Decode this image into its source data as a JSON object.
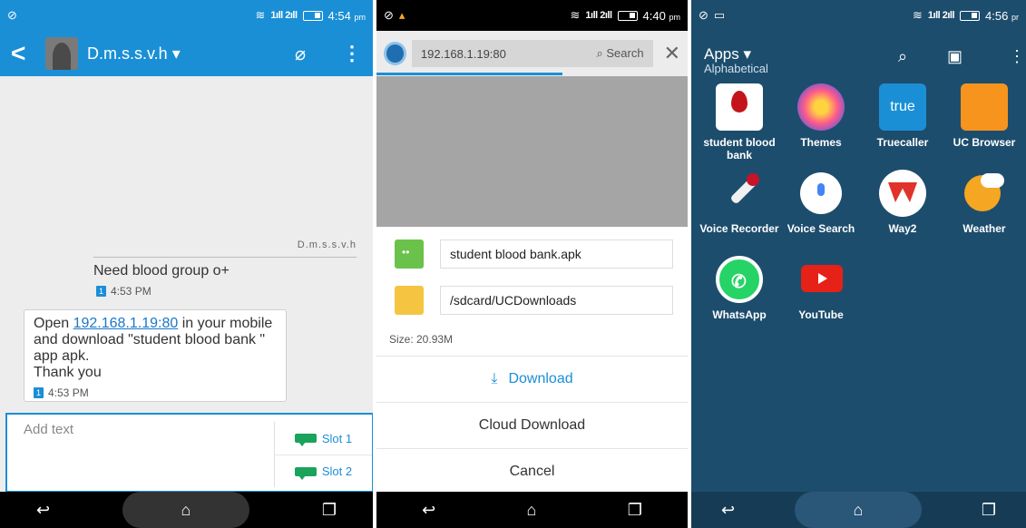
{
  "phone1": {
    "status_time": "4:54",
    "status_ampm": "pm",
    "contact_name": "D.m.s.s.v.h",
    "sender_label": "D.m.s.s.v.h",
    "incoming_message": "Need blood group o+",
    "incoming_time": "4:53 PM",
    "outgoing_prefix": "Open ",
    "outgoing_link": "192.168.1.19:80",
    "outgoing_rest": " in your mobile and download \"student blood bank \" app apk.",
    "outgoing_thanks": "Thank you",
    "outgoing_time": "4:53 PM",
    "sim_badge": "1",
    "composer_placeholder": "Add text",
    "slot1_label": "Slot 1",
    "slot2_label": "Slot 2"
  },
  "phone2": {
    "status_time": "4:40",
    "status_ampm": "pm",
    "url": "192.168.1.19:80",
    "search_label": "Search",
    "file_name": "student  blood bank.apk",
    "folder_path": "/sdcard/UCDownloads",
    "size_text": "Size: 20.93M",
    "download_label": "Download",
    "cloud_download_label": "Cloud Download",
    "cancel_label": "Cancel"
  },
  "phone3": {
    "status_time": "4:56",
    "status_ampm": "pr",
    "title": "Apps",
    "subtitle": "Alphabetical",
    "apps": [
      {
        "name": "student blood bank",
        "icon": "blood-drop-icon",
        "color": "#ffffff"
      },
      {
        "name": "Themes",
        "icon": "themes-icon",
        "color": "#e83a7a"
      },
      {
        "name": "Truecaller",
        "icon": "truecaller-icon",
        "color": "#1a8fd6",
        "icon_text": "true"
      },
      {
        "name": "UC Browser",
        "icon": "uc-browser-icon",
        "color": "#f7941d"
      },
      {
        "name": "Voice Recorder",
        "icon": "microphone-icon",
        "color": "#ffffff"
      },
      {
        "name": "Voice Search",
        "icon": "voice-search-icon",
        "color": "#ffffff"
      },
      {
        "name": "Way2",
        "icon": "way2-icon",
        "color": "#e0332b"
      },
      {
        "name": "Weather",
        "icon": "weather-icon",
        "color": "#f5a623"
      },
      {
        "name": "WhatsApp",
        "icon": "whatsapp-icon",
        "color": "#25d366"
      },
      {
        "name": "YouTube",
        "icon": "youtube-icon",
        "color": "#e62117"
      }
    ]
  }
}
